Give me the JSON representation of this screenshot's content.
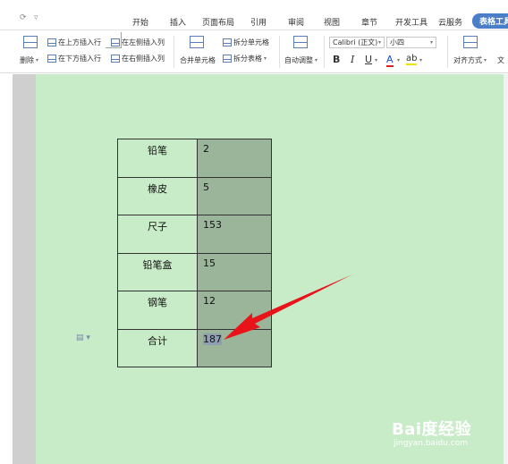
{
  "quick_access": {
    "redo": "⟳",
    "more": "▿"
  },
  "tabs": [
    {
      "label": "开始"
    },
    {
      "label": "插入"
    },
    {
      "label": "页面布局"
    },
    {
      "label": "引用"
    },
    {
      "label": "审阅"
    },
    {
      "label": "视图"
    },
    {
      "label": "章节"
    },
    {
      "label": "开发工具"
    },
    {
      "label": "云服务"
    },
    {
      "label": "表格工具"
    }
  ],
  "toolbar": {
    "delete": "删除",
    "insert_above": "在上方插入行",
    "insert_below": "在下方插入行",
    "insert_left": "在左侧插入列",
    "insert_right": "在右侧插入列",
    "merge": "合并单元格",
    "split_cell": "拆分单元格",
    "split_table": "拆分表格",
    "autofit": "自动调整",
    "font_name": "Calibri (正文)",
    "font_size": "小四",
    "bold": "B",
    "italic": "I",
    "underline": "U",
    "font_color": "A",
    "highlight": "ab",
    "align": "对齐方式",
    "text_dir": "文"
  },
  "table": {
    "rows": [
      {
        "name": "铅笔",
        "value": "2"
      },
      {
        "name": "橡皮",
        "value": "5"
      },
      {
        "name": "尺子",
        "value": "153"
      },
      {
        "name": "铅笔盒",
        "value": "15"
      },
      {
        "name": "钢笔",
        "value": "12"
      },
      {
        "name": "合计",
        "value": "187"
      }
    ]
  },
  "watermark": {
    "main": "Bai度经验",
    "sub": "jingyan.baidu.com"
  },
  "colors": {
    "page_bg": "#c8ebc8",
    "value_col": "#9ab59a",
    "active_tab": "#4a7ec9",
    "arrow": "#e8141a"
  }
}
